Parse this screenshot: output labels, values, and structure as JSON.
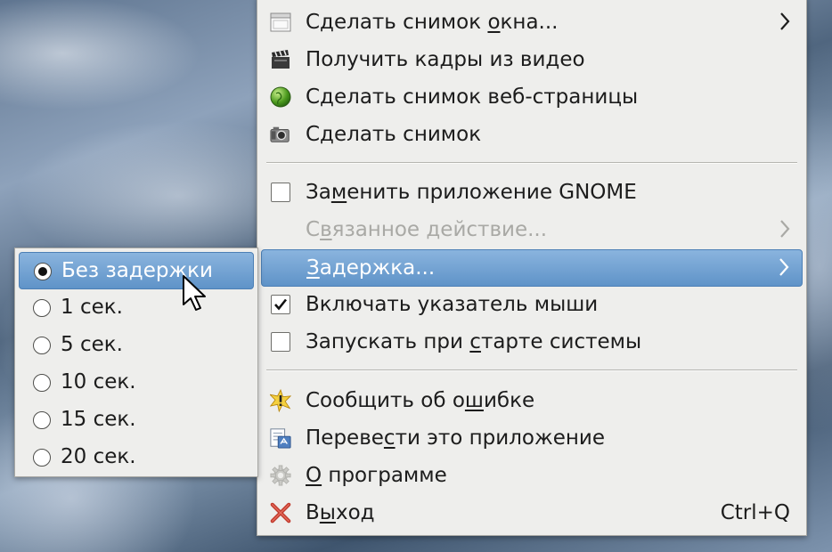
{
  "main_menu": {
    "items": [
      {
        "pre": "Сделать снимок ",
        "acc": "о",
        "post": "кна...",
        "icon": "window-screenshot-icon",
        "submenu": true
      },
      {
        "pre": "",
        "acc": "",
        "post": "Получить кадры из видео",
        "icon": "clapperboard-icon"
      },
      {
        "pre": "",
        "acc": "",
        "post": "Сделать снимок веб-страницы",
        "icon": "globe-icon"
      },
      {
        "pre": "",
        "acc": "",
        "post": "Сделать снимок",
        "icon": "camera-icon"
      },
      {
        "pre": "За",
        "acc": "м",
        "post": "енить приложение GNOME",
        "checked": false
      },
      {
        "pre": "С",
        "acc": "в",
        "post": "язанное действие...",
        "disabled": true,
        "submenu": true
      },
      {
        "pre": "",
        "acc": "З",
        "post": "адержка...",
        "highlighted": true,
        "submenu": true
      },
      {
        "pre": "",
        "acc": "",
        "post": "Включать указатель мыши",
        "checked": true
      },
      {
        "pre": "Запускать при ",
        "acc": "с",
        "post": "тарте системы",
        "checked": false
      },
      {
        "pre": "Сообщить об о",
        "acc": "ш",
        "post": "ибке",
        "icon": "bug-warning-icon"
      },
      {
        "pre": "Переве",
        "acc": "с",
        "post": "ти это приложение",
        "icon": "translate-icon"
      },
      {
        "pre": "",
        "acc": "О",
        "post": " программе",
        "icon": "gear-icon",
        "disabled_icon": true
      },
      {
        "pre": "В",
        "acc": "ы",
        "post": "ход",
        "icon": "close-icon",
        "accel": "Ctrl+Q"
      }
    ]
  },
  "delay_menu": {
    "items": [
      {
        "label": "Без задержки",
        "selected": true
      },
      {
        "label": "1 сек.",
        "selected": false
      },
      {
        "label": "5 сек.",
        "selected": false
      },
      {
        "label": "10 сек.",
        "selected": false
      },
      {
        "label": "15 сек.",
        "selected": false
      },
      {
        "label": "20 сек.",
        "selected": false
      }
    ]
  },
  "colors": {
    "menu_bg": "#eeeeec",
    "highlight": "#6a9bcf",
    "disabled_text": "#a9a9a5"
  }
}
